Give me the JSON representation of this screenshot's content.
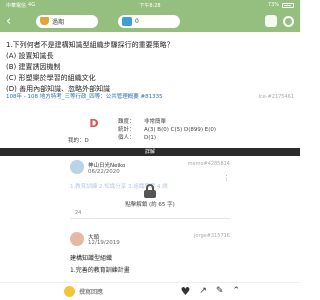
{
  "statusbar": {
    "carrier": "中華電信",
    "network": "4G",
    "time": "下午8:28",
    "battery": "73%"
  },
  "nav": {
    "back_icon": "‹",
    "level_label": "過期",
    "gem_count": "0"
  },
  "question": {
    "title": "1.下列何者不是建構知識型組織步驟採行的重要策略？",
    "options": [
      "(A) 設置知識長",
      "(B) 建置誘因機制",
      "(C) 形塑樂於學習的組織文化",
      "(D) 善用內部知識、忽略外部知識"
    ],
    "tags": "108年 - 108 地方特考_三等行政_四等：公共管理概要 #81335",
    "id": "Ice-#2175461"
  },
  "stats": {
    "grade": "D",
    "my_answer": "我的：D",
    "difficulty_k": "難度：",
    "difficulty_v": "非常簡單",
    "stats_k": "統計：",
    "stats_v": "A(3) B(0) C(5) D(899) E(0)",
    "personal_k": "個人：",
    "personal_v": "D(1)"
  },
  "section_label": "詳解",
  "post1": {
    "user": "神山日光Neiko",
    "date": "06/22/2020",
    "id": "memo#4285814",
    "locked_text": "1.教育訓練 2.知識分享 3.組織學習 4.誘",
    "unlock_label": "點擊解鎖 (約 65 字)",
    "likes": "24"
  },
  "post2": {
    "user": "大頭",
    "date": "12/19/2019",
    "id": "jorge#315716",
    "lines": [
      "建構知識型組織",
      "1.完善的教育訓練計畫"
    ]
  },
  "bottom": {
    "reply_label": "撰寫回應"
  }
}
